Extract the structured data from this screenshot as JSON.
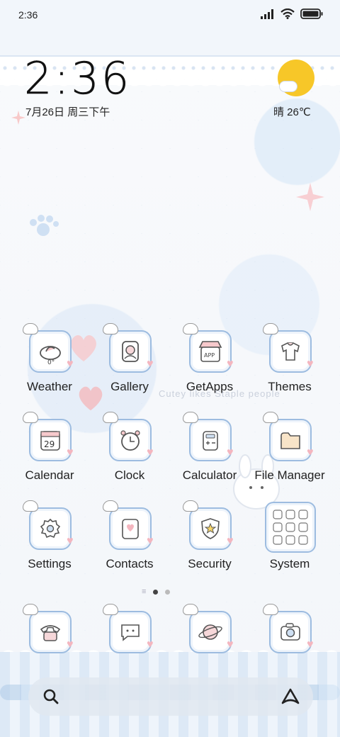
{
  "status_bar": {
    "time": "2:36",
    "icons": [
      "signal-icon",
      "wifi-icon",
      "battery-icon"
    ]
  },
  "clock_widget": {
    "time": "2:36",
    "date": "7月26日 周三下午"
  },
  "weather_widget": {
    "condition_icon": "sun-cloud-icon",
    "text": "晴 26℃"
  },
  "wallpaper_text": "Cutey likes Staple people",
  "apps_grid": [
    {
      "label": "Weather",
      "icon": "weather-icon"
    },
    {
      "label": "Gallery",
      "icon": "gallery-icon"
    },
    {
      "label": "GetApps",
      "icon": "getapps-icon"
    },
    {
      "label": "Themes",
      "icon": "themes-icon"
    },
    {
      "label": "Calendar",
      "icon": "calendar-icon",
      "icon_text": "29"
    },
    {
      "label": "Clock",
      "icon": "clock-icon"
    },
    {
      "label": "Calculator",
      "icon": "calculator-icon"
    },
    {
      "label": "File Manager",
      "icon": "folder-icon"
    },
    {
      "label": "Settings",
      "icon": "settings-icon"
    },
    {
      "label": "Contacts",
      "icon": "contacts-icon"
    },
    {
      "label": "Security",
      "icon": "security-icon"
    },
    {
      "label": "System",
      "icon": "system-folder-icon"
    }
  ],
  "getapps_icon_text": "APP",
  "weather_icon_text": "0°",
  "page_indicator": {
    "pages": 2,
    "current": 1
  },
  "dock": [
    {
      "icon": "phone-icon"
    },
    {
      "icon": "messages-icon"
    },
    {
      "icon": "browser-icon"
    },
    {
      "icon": "camera-icon"
    }
  ],
  "search_bar": {
    "left_icon": "search-icon",
    "right_icon": "assistant-icon"
  },
  "colors": {
    "tile_border": "#9dbce0",
    "heart": "#f4b6bf",
    "sun": "#f7c728",
    "stripe_light": "#eef4fb",
    "stripe_dark": "#dde9f6"
  }
}
